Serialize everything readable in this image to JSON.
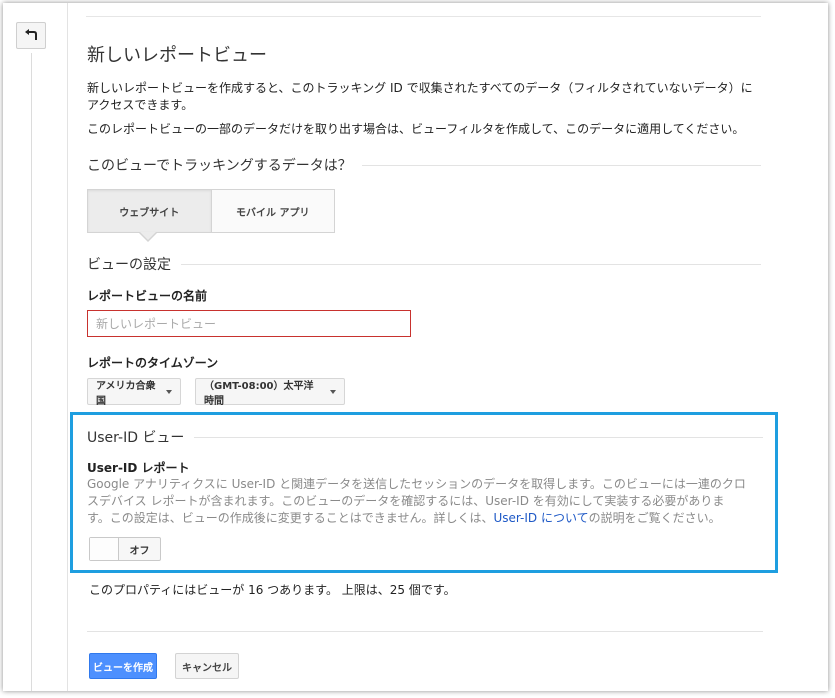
{
  "header": {
    "title": "新しいレポートビュー"
  },
  "intro": {
    "line1": "新しいレポートビューを作成すると、このトラッキング ID で収集されたすべてのデータ（フィルタされていないデータ）にアクセスできます。",
    "line2": "このレポートビューの一部のデータだけを取り出す場合は、ビューフィルタを作成して、このデータに適用してください。"
  },
  "tracking": {
    "heading": "このビューでトラッキングするデータは？",
    "options": [
      "ウェブサイト",
      "モバイル アプリ"
    ],
    "selected": "ウェブサイト"
  },
  "view_settings": {
    "heading": "ビューの設定",
    "name_label": "レポートビューの名前",
    "name_placeholder": "新しいレポートビュー",
    "name_value": "",
    "timezone_label": "レポートのタイムゾーン",
    "country": "アメリカ合衆国",
    "timezone": "（GMT-08:00）太平洋時間"
  },
  "user_id": {
    "heading": "User-ID ビュー",
    "label": "User-ID レポート",
    "desc_main": "Google アナリティクスに User-ID と関連データを送信したセッションのデータを取得します。このビューには一連のクロスデバイス レポートが含まれます。このビューのデータを確認するには、User-ID を有効にして実装する必要があります。この設定は、ビューの作成後に変更することはできません。詳しくは、",
    "desc_link": "User-ID について",
    "desc_tail": "の説明をご覧ください。",
    "toggle_state": "オフ"
  },
  "quota": {
    "text": "このプロパティにはビューが 16 つあります。 上限は、25 個です。"
  },
  "actions": {
    "create": "ビューを作成",
    "cancel": "キャンセル"
  },
  "colors": {
    "primary": "#4d90fe",
    "highlight": "#1e9ee0",
    "error_border": "#c8322e",
    "link": "#1d58c6"
  },
  "icons": {
    "back": "back-arrow-icon"
  }
}
